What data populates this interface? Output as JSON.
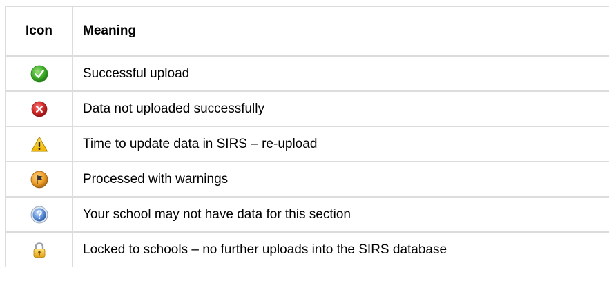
{
  "table": {
    "headers": {
      "icon": "Icon",
      "meaning": "Meaning"
    },
    "rows": [
      {
        "icon": "check-success-icon",
        "meaning": "Successful upload"
      },
      {
        "icon": "error-x-icon",
        "meaning": "Data not uploaded successfully"
      },
      {
        "icon": "warning-triangle-icon",
        "meaning": "Time to update data in SIRS – re-upload"
      },
      {
        "icon": "flag-warning-icon",
        "meaning": "Processed with warnings"
      },
      {
        "icon": "question-help-icon",
        "meaning": "Your school may not have data for this section"
      },
      {
        "icon": "lock-icon",
        "meaning": "Locked to schools – no further uploads into the SIRS database"
      }
    ]
  },
  "colors": {
    "border": "#dcdcdc",
    "success": "#3fae2a",
    "error": "#d42a2a",
    "warning": "#f5c400",
    "flag": "#f0a22a",
    "help": "#6b9be0",
    "lock": "#f2b81e"
  }
}
